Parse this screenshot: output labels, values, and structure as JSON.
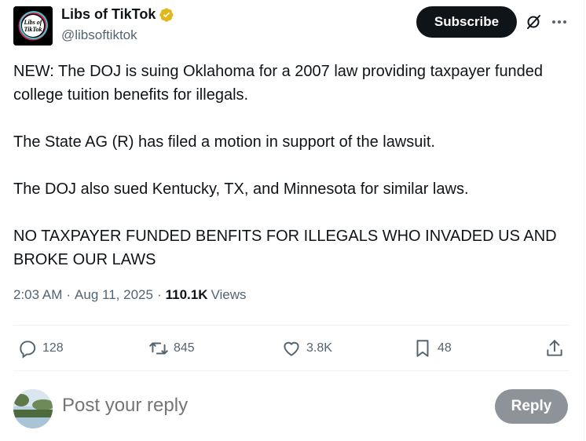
{
  "author": {
    "display_name": "Libs of TikTok",
    "handle": "@libsoftiktok",
    "avatar_text_line1": "Libs of",
    "avatar_text_line2": "TikTok"
  },
  "header": {
    "subscribe_label": "Subscribe",
    "grok_icon": "grok-icon",
    "more_icon": "more-icon"
  },
  "post": {
    "paragraphs": [
      "NEW: The DOJ is suing Oklahoma for a 2007 law providing taxpayer funded college tuition benefits for illegals.",
      "The State AG (R) has filed a motion in support of the lawsuit.",
      "The DOJ also sued Kentucky, TX, and Minnesota for similar laws.",
      "NO TAXPAYER FUNDED BENFITS FOR ILLEGALS WHO INVADED US AND BROKE OUR LAWS"
    ]
  },
  "meta": {
    "time": "2:03 AM",
    "separator": "·",
    "date": "Aug 11, 2025",
    "views_count": "110.1K",
    "views_label": "Views"
  },
  "actions": {
    "replies": "128",
    "reposts": "845",
    "likes": "3.8K",
    "bookmarks": "48"
  },
  "reply_box": {
    "placeholder": "Post your reply",
    "button_label": "Reply"
  },
  "colors": {
    "text_primary": "#0f1419",
    "text_secondary": "#536471",
    "verified_gold": "#e2b719",
    "reply_button_disabled": "#8d9399"
  }
}
